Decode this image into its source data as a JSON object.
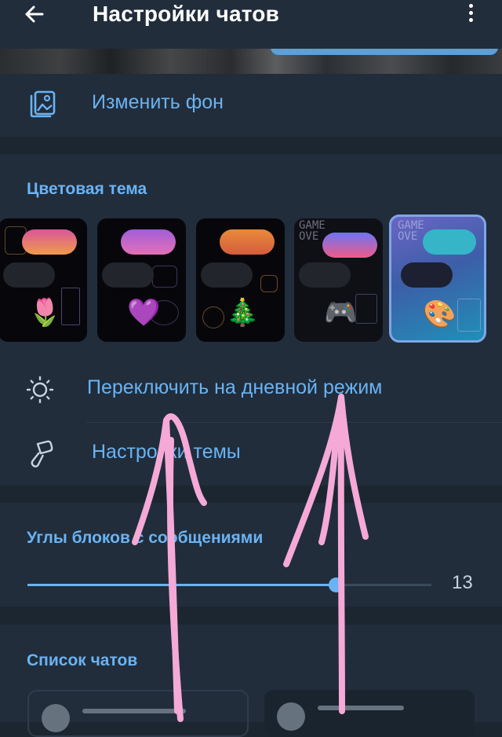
{
  "header": {
    "title": "Настройки чатов",
    "back_icon": "arrow-left-icon",
    "menu_icon": "more-vertical-icon"
  },
  "rows": {
    "change_wallpaper": "Изменить фон",
    "switch_day_mode": "Переключить на дневной режим",
    "theme_settings": "Настройки темы"
  },
  "sections": {
    "color_theme": "Цветовая тема",
    "message_corners": "Углы блоков с сообщениями",
    "chat_list": "Список чатов"
  },
  "themes": [
    {
      "emoji": "🌷",
      "pill_colors": [
        "#d8579a",
        "#f19a4a"
      ],
      "doodle_color": "#b38a43",
      "selected": false
    },
    {
      "emoji": "💜",
      "pill_colors": [
        "#a15ed8",
        "#e46fb7"
      ],
      "doodle_color": "#7d5aa9",
      "selected": false
    },
    {
      "emoji": "🎄",
      "pill_colors": [
        "#e88a3a",
        "#d55d3c"
      ],
      "doodle_color": "#d4873f",
      "selected": false
    },
    {
      "emoji": "🎮",
      "pill_colors": [
        "#6d74f2",
        "#f05b8a"
      ],
      "doodle_color": "#6970a6",
      "selected": false
    },
    {
      "emoji": "🎨",
      "pill_colors": [
        "#37b5c8",
        "#37b5c8"
      ],
      "doodle_color": "#8c8fc7",
      "selected": true
    }
  ],
  "corners_slider": {
    "value": "13",
    "fraction": 0.763
  },
  "colors": {
    "accent": "#6ab3f3",
    "background": "#1c2631",
    "card": "#212d3b",
    "annotation": "#f5a9d6"
  }
}
